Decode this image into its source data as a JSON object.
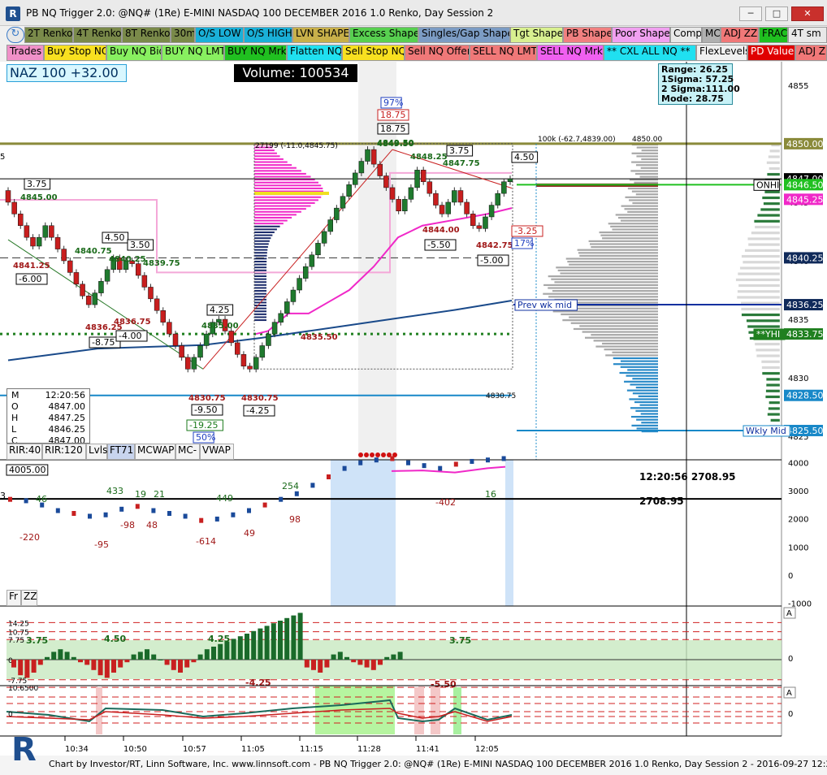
{
  "window": {
    "title": "PB NQ Trigger 2.0: @NQ# (1Re) E-MINI NASDAQ 100 DECEMBER 2016 1.0 Renko, Day Session 2",
    "app_icon": "R"
  },
  "toolbar1": [
    {
      "label": "2T Renko",
      "bg": "#7a8a4a",
      "fg": "#000000"
    },
    {
      "label": "4T Renko",
      "bg": "#7a8a4a",
      "fg": "#000000"
    },
    {
      "label": "8T Renko",
      "bg": "#7a8a4a",
      "fg": "#000000"
    },
    {
      "label": "30m",
      "bg": "#7a8a4a",
      "fg": "#000000"
    },
    {
      "label": "O/S LOW",
      "bg": "#1ab0d8",
      "fg": "#000000"
    },
    {
      "label": "O/S HIGH",
      "bg": "#1ab0d8",
      "fg": "#000000"
    },
    {
      "label": "LVN SHAPE",
      "bg": "#c8b04a",
      "fg": "#000000"
    },
    {
      "label": "Excess Shape",
      "bg": "#58d050",
      "fg": "#000000"
    },
    {
      "label": "Singles/Gap Shape",
      "bg": "#7c9cc4",
      "fg": "#000000"
    },
    {
      "label": "Tgt Shape",
      "bg": "#d8f090",
      "fg": "#000000"
    },
    {
      "label": "PB Shape",
      "bg": "#f08080",
      "fg": "#000000"
    },
    {
      "label": "Poor Shape",
      "bg": "#f0a0f0",
      "fg": "#000000"
    },
    {
      "label": "Comp",
      "bg": "#e8e8e8",
      "fg": "#000000"
    },
    {
      "label": "MC",
      "bg": "#b0b0b0",
      "fg": "#000000"
    },
    {
      "label": "ADJ ZZ",
      "bg": "#f07878",
      "fg": "#000000"
    },
    {
      "label": "FRAC",
      "bg": "#20c020",
      "fg": "#000000"
    },
    {
      "label": "4T sm",
      "bg": "#e8e8e8",
      "fg": "#000000"
    }
  ],
  "toolbar2": [
    {
      "label": "Trades",
      "bg": "#f090c8",
      "fg": "#000000"
    },
    {
      "label": "Buy Stop NQ",
      "bg": "#f8e020",
      "fg": "#000000"
    },
    {
      "label": "Buy NQ Bid",
      "bg": "#88f060",
      "fg": "#000000"
    },
    {
      "label": "BUY NQ LMT",
      "bg": "#88f060",
      "fg": "#000000"
    },
    {
      "label": "BUY NQ Mrkt",
      "bg": "#20c020",
      "fg": "#000000"
    },
    {
      "label": "Flatten NQ",
      "bg": "#20e0f0",
      "fg": "#000000"
    },
    {
      "label": "Sell Stop NQ",
      "bg": "#f8e020",
      "fg": "#000000"
    },
    {
      "label": "Sell NQ Offer",
      "bg": "#f07878",
      "fg": "#000000"
    },
    {
      "label": "SELL NQ LMT",
      "bg": "#f07878",
      "fg": "#000000"
    },
    {
      "label": "SELL NQ Mrkt",
      "bg": "#f060f0",
      "fg": "#000000"
    },
    {
      "label": "** CXL ALL NQ **",
      "bg": "#20e0f0",
      "fg": "#000000"
    },
    {
      "label": "FlexLevels",
      "bg": "#f0f0f0",
      "fg": "#000000"
    },
    {
      "label": "PD Value",
      "bg": "#e00000",
      "fg": "#ffffff"
    },
    {
      "label": "ADJ Z",
      "bg": "#f07878",
      "fg": "#000000"
    }
  ],
  "badges": {
    "naz": "NAZ 100 +32.00",
    "volume": "Volume: 100534"
  },
  "stats": {
    "range": "Range: 26.25",
    "sigma1": "1Sigma: 57.25",
    "sigma2": "2 Sigma:111.00",
    "mode": "Mode: 28.75"
  },
  "ohlc": {
    "time_label": "M",
    "time": "12:20:56",
    "o_label": "O",
    "o": "4847.00",
    "h_label": "H",
    "h": "4847.25",
    "l_label": "L",
    "l": "4846.25",
    "c_label": "C",
    "c": "4847.00"
  },
  "indicator_tabs_1": [
    "RIR:40",
    "RIR:120",
    "Lvls",
    "FT71",
    "MCWAP",
    "MC-",
    "VWAP"
  ],
  "indicator_tabs_2": [
    "Fr",
    "ZZ"
  ],
  "price_axis": {
    "ticks": [
      "4855",
      "4850",
      "4845",
      "4840",
      "4835",
      "4830",
      "4825"
    ],
    "labels": [
      {
        "text": "4850.00",
        "bg": "#8a8a3a",
        "fg": "#ffffff",
        "price": 4850.0
      },
      {
        "text": "4847.00",
        "bg": "#000000",
        "fg": "#ffffff",
        "price": 4847.0
      },
      {
        "text": "4846.50",
        "bg": "#20c020",
        "fg": "#ffffff",
        "price": 4846.5
      },
      {
        "text": "4845.25",
        "bg": "#f028c8",
        "fg": "#ffffff",
        "price": 4845.25
      },
      {
        "text": "4840.25",
        "bg": "#102a5a",
        "fg": "#ffffff",
        "price": 4840.25
      },
      {
        "text": "4836.25",
        "bg": "#102a5a",
        "fg": "#ffffff",
        "price": 4836.25
      },
      {
        "text": "4833.75",
        "bg": "#208020",
        "fg": "#ffffff",
        "price": 4833.75
      },
      {
        "text": "4828.50",
        "bg": "#1888c8",
        "fg": "#ffffff",
        "price": 4828.5
      },
      {
        "text": "4825.50",
        "bg": "#1888c8",
        "fg": "#ffffff",
        "price": 4825.5
      }
    ],
    "tags": [
      "ONHI",
      "**YHI",
      "Wkly Mid"
    ]
  },
  "chart_annotations": {
    "swing_labels": [
      "4845.00",
      "4840.75",
      "4840.25",
      "4839.75",
      "4841.25",
      "4836.25",
      "4836.75",
      "4835.00",
      "4830.75",
      "4830.75",
      "4835.50",
      "4849.50",
      "4848.25",
      "4847.75",
      "4844.00",
      "4842.75"
    ],
    "boxes": [
      "3.75",
      "4.50",
      "3.50",
      "-6.00",
      "-8.75",
      "-4.00",
      "4.25",
      "-9.50",
      "-4.25",
      "-19.25",
      "18.75",
      "18.75",
      "3.75",
      "4.50",
      "-5.50",
      "-5.00",
      "-3.25"
    ],
    "percents": [
      "97%",
      "50%",
      "17%"
    ],
    "top_texts": [
      "27199 (-11.0,4845.75)",
      "4849.50",
      "100k (-62.7,4839.00)",
      "4850.00",
      "4830.75"
    ],
    "prev_wk_mid": "Prev wk mid",
    "left_edge": "5"
  },
  "vol_panel": {
    "time_value": "12:20:56  2708.95",
    "last_value": "2708.95",
    "axis_ticks": [
      "4000",
      "3000",
      "2000",
      "1000",
      "0",
      "-1000"
    ],
    "axis_label_top": "4005.00",
    "numbers_up": [
      "46",
      "433",
      "19",
      "21",
      "449",
      "254",
      "16"
    ],
    "numbers_down": [
      "-220",
      "-95",
      "-98",
      "48",
      "-614",
      "49",
      "98",
      "-402"
    ],
    "left_edge": "3"
  },
  "osc_panel": {
    "levels": [
      "14.25",
      "10.75",
      "7.75",
      "0",
      "-7.75",
      "10.6500"
    ],
    "labels": [
      "3.75",
      "4.50",
      "4.25",
      "-4.25",
      "3.75",
      "-5.50"
    ],
    "axis_ticks": [
      "0"
    ],
    "axis_top": "A"
  },
  "sub_panel": {
    "axis_ticks": [
      "0"
    ],
    "axis_top": "A",
    "left_tag": "0"
  },
  "time_axis": [
    "10:34",
    "10:50",
    "10:57",
    "11:05",
    "11:15",
    "11:28",
    "11:41",
    "12:05"
  ],
  "footer": {
    "text": "Chart by Investor/RT, Linn Software, Inc. www.linnsoft.com - PB NQ Trigger 2.0: @NQ# (1Re) E-MINI NASDAQ 100 DECEMBER 2016 1.0 Renko, Day Session 2 - 2016-09-27 12:20:52",
    "logo": "R"
  },
  "colors": {
    "up_candle": "#1f7a2e",
    "down_candle": "#c81e1e",
    "poc_pink": "#f028c8",
    "vwap_blue": "#1a4a8a",
    "green_line": "#20c020"
  },
  "chart_data": {
    "type": "candlestick",
    "title": "PB NQ Trigger 2.0: @NQ# (1Re) E-MINI NASDAQ 100 DECEMBER 2016 1.0 Renko, Day Session 2",
    "ylim": [
      4823,
      4857
    ],
    "last": 4847.0,
    "closes": [
      4845.0,
      4844.0,
      4843.0,
      4842.0,
      4841.25,
      4842.0,
      4843.0,
      4842.0,
      4841.0,
      4840.0,
      4839.0,
      4838.0,
      4837.0,
      4836.25,
      4837.25,
      4838.25,
      4839.25,
      4840.25,
      4839.25,
      4840.0,
      4839.75,
      4838.75,
      4837.75,
      4836.75,
      4835.75,
      4834.75,
      4833.75,
      4832.75,
      4831.75,
      4830.75,
      4831.75,
      4832.75,
      4833.75,
      4834.75,
      4835.0,
      4834.0,
      4833.0,
      4832.0,
      4831.0,
      4830.75,
      4831.75,
      4832.75,
      4833.75,
      4834.75,
      4835.5,
      4836.5,
      4837.5,
      4838.5,
      4839.5,
      4840.5,
      4841.5,
      4842.5,
      4843.5,
      4844.5,
      4845.5,
      4846.5,
      4847.5,
      4848.5,
      4849.5,
      4848.25,
      4847.25,
      4846.25,
      4845.25,
      4844.25,
      4845.25,
      4846.25,
      4847.75,
      4846.75,
      4845.75,
      4844.75,
      4844.0,
      4845.0,
      4846.0,
      4845.0,
      4844.0,
      4843.0,
      4842.75,
      4843.75,
      4844.75,
      4845.75,
      4846.75,
      4847.0
    ]
  }
}
